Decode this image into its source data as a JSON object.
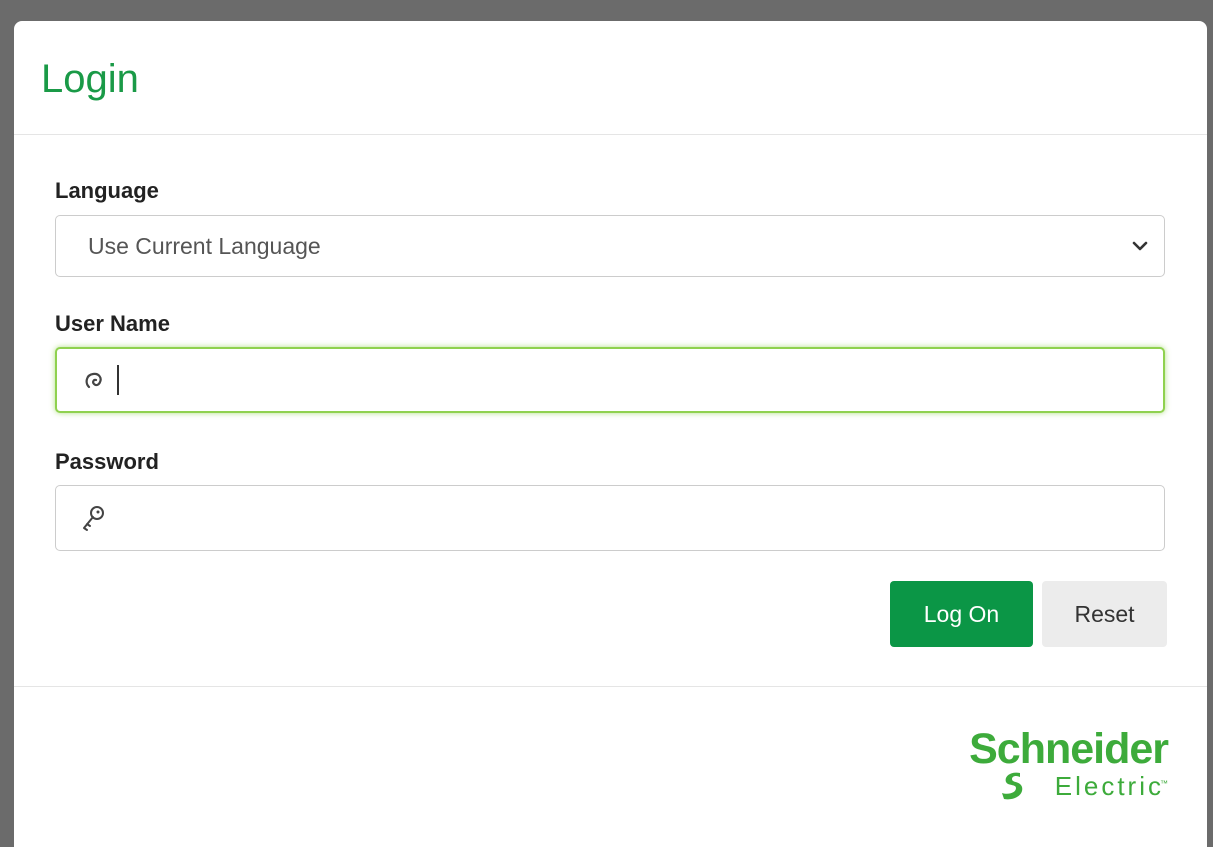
{
  "dialog": {
    "title": "Login"
  },
  "form": {
    "language": {
      "label": "Language",
      "selected": "Use Current Language"
    },
    "username": {
      "label": "User Name",
      "value": "",
      "icon": "user-icon"
    },
    "password": {
      "label": "Password",
      "value": "",
      "icon": "key-icon"
    }
  },
  "buttons": {
    "log_on": "Log On",
    "reset": "Reset"
  },
  "logo": {
    "word": "Schneider",
    "sub": "Electric",
    "tm": "™"
  },
  "colors": {
    "title_green": "#1a9a47",
    "primary_button": "#0b9646",
    "focus_border": "#8fd14f",
    "logo_green": "#3dab3b"
  }
}
